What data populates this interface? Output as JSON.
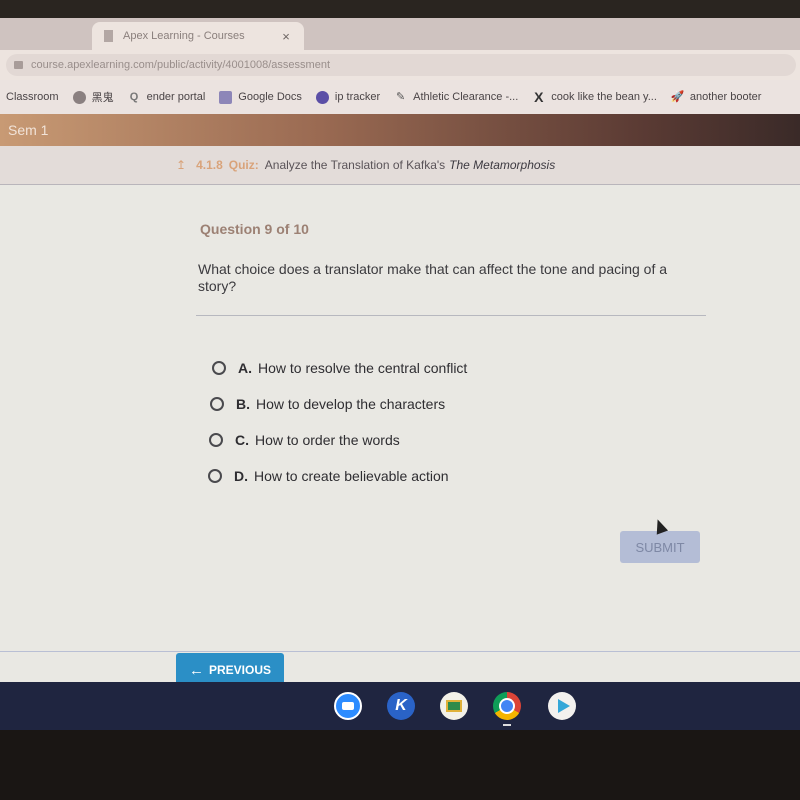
{
  "browser": {
    "tab_title": "Apex Learning - Courses",
    "tab_close": "×",
    "url": "course.apexlearning.com/public/activity/4001008/assessment",
    "bookmarks": [
      {
        "label": "Classroom",
        "icon": "none"
      },
      {
        "label": "黑鬼",
        "icon": "globe-icon"
      },
      {
        "label": "ender portal",
        "icon": "q-icon"
      },
      {
        "label": "Google Docs",
        "icon": "docs-icon"
      },
      {
        "label": "ip tracker",
        "icon": "circle-icon"
      },
      {
        "label": "Athletic Clearance -...",
        "icon": "pencil-icon"
      },
      {
        "label": "cook like the bean y...",
        "icon": "x-icon"
      },
      {
        "label": "another booter",
        "icon": "rocket-icon"
      }
    ]
  },
  "course": {
    "name": "Sem 1"
  },
  "breadcrumb": {
    "up_icon": "↥",
    "number": "4.1.8",
    "type": "Quiz:",
    "title": "Analyze the Translation of Kafka's",
    "title_italic": "The Metamorphosis"
  },
  "question": {
    "counter": "Question 9 of 10",
    "text": "What choice does a translator make that can affect the tone and pacing of a story?",
    "options": [
      {
        "letter": "A.",
        "text": "How to resolve the central conflict",
        "selected": false
      },
      {
        "letter": "B.",
        "text": "How to develop the characters",
        "selected": false
      },
      {
        "letter": "C.",
        "text": "How to order the words",
        "selected": false
      },
      {
        "letter": "D.",
        "text": "How to create believable action",
        "selected": false
      }
    ]
  },
  "actions": {
    "submit_label": "SUBMIT",
    "previous_label": "PREVIOUS",
    "previous_arrow": "←"
  },
  "shelf": {
    "apps": [
      "Zoom",
      "Kahoot",
      "Google Classroom",
      "Chrome",
      "Play Store"
    ],
    "k_label": "K"
  }
}
